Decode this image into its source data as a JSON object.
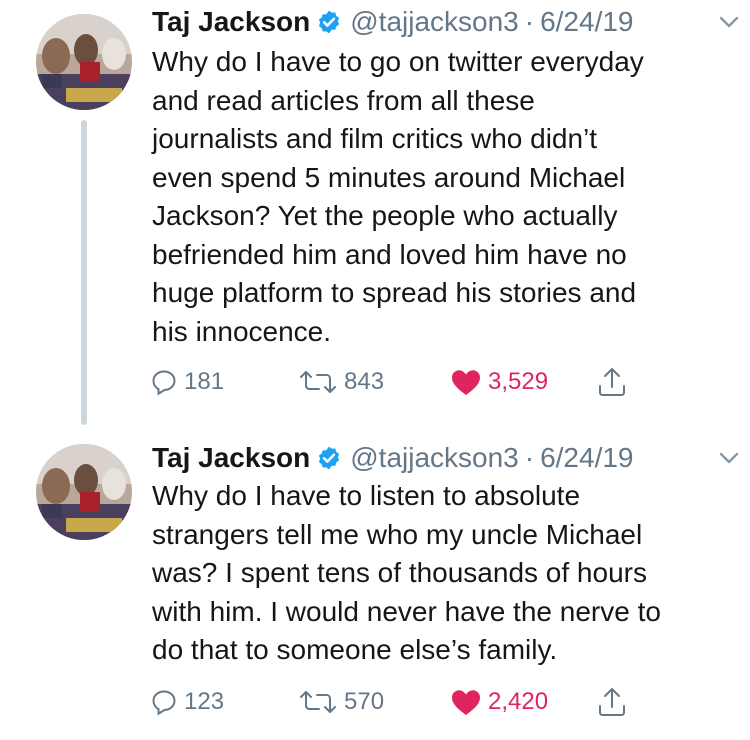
{
  "tweets": [
    {
      "name": "Taj Jackson",
      "handle": "@tajjackson3",
      "separator": "·",
      "date": "6/24/19",
      "text": "Why do I have to go on twitter everyday\nand read articles from all these\njournalists and film critics who didn’t\neven spend 5 minutes around Michael\nJackson? Yet the people who actually\nbefriended him and loved him have no\nhuge platform to spread his stories and\nhis innocence.",
      "replies": "181",
      "retweets": "843",
      "likes": "3,529"
    },
    {
      "name": "Taj Jackson",
      "handle": "@tajjackson3",
      "separator": "·",
      "date": "6/24/19",
      "text": "Why do I have to listen to absolute\nstrangers tell me who my uncle Michael\nwas? I spent tens of thousands of hours\nwith him. I would never have the nerve to\ndo that to someone else’s family.",
      "replies": "123",
      "retweets": "570",
      "likes": "2,420"
    }
  ],
  "colors": {
    "verified": "#1da1f2",
    "like": "#e0245e",
    "muted": "#657786",
    "thread": "#ccd6dd"
  },
  "icons": [
    "verified-badge-icon",
    "chevron-down-icon",
    "reply-icon",
    "retweet-icon",
    "heart-icon",
    "share-icon"
  ]
}
